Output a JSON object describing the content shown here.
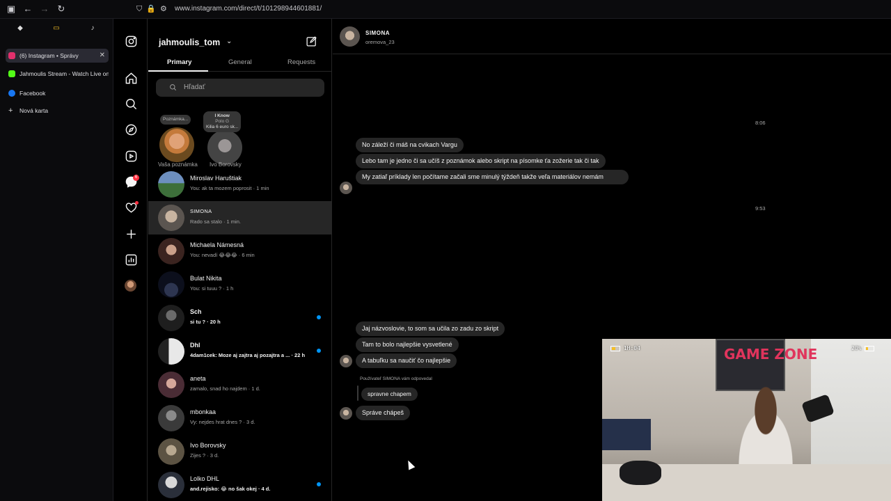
{
  "browser": {
    "url": "www.instagram.com/direct/t/101298944601881/",
    "tabs": [
      {
        "label": "(6) Instagram • Správy",
        "active": true,
        "favicon_color": "#e1306c"
      },
      {
        "label": "Jahmoulis Stream - Watch Live on K",
        "active": false,
        "favicon_color": "#53fc18"
      },
      {
        "label": "Facebook",
        "active": false,
        "favicon_color": "#1877f2"
      },
      {
        "label": "Nová karta",
        "active": false,
        "favicon_color": ""
      }
    ]
  },
  "nav": {
    "icons": [
      "instagram-logo-icon",
      "home-icon",
      "search-icon",
      "explore-icon",
      "reels-icon",
      "messenger-icon",
      "heart-icon",
      "create-icon",
      "dashboard-icon",
      "profile-avatar"
    ],
    "messages_badge": "6"
  },
  "inbox": {
    "username": "jahmoulis_tom",
    "tabs": [
      "Primary",
      "General",
      "Requests"
    ],
    "search_placeholder": "Hľadať",
    "notes": [
      {
        "bubble": "Poznámka...",
        "label": "Vaša poznámka"
      },
      {
        "bubble_line1": "I Know",
        "bubble_line2": "Polo G",
        "bubble_line3": "Kilia 6 euro sk...",
        "label": "Ivo Borovsky"
      }
    ],
    "conversations": [
      {
        "name": "Miroslav Haruštiak",
        "preview": "You: ak ta mozem poprosit · 1 min",
        "unread": false,
        "active": false
      },
      {
        "name": "SIMONA",
        "preview": "Rado sa stalo · 1 min.",
        "unread": false,
        "active": true
      },
      {
        "name": "Michaela Námesná",
        "preview": "You: nevadí 😂😂😂 · 6 min",
        "unread": false,
        "active": false
      },
      {
        "name": "Bulat Nikita",
        "preview": "You: si tuuu ? · 1 h",
        "unread": false,
        "active": false
      },
      {
        "name": "Sch",
        "preview": "si tu ? · 20 h",
        "unread": true,
        "active": false
      },
      {
        "name": "Dhl",
        "preview": "4dam1cek: Moze aj zajtra aj pozajtra a ... · 22 h",
        "unread": true,
        "active": false
      },
      {
        "name": "aneta",
        "preview": "zamalo, snad ho najdem · 1 d.",
        "unread": false,
        "active": false
      },
      {
        "name": "mbonkaa",
        "preview": "Vy: nejdes hrat dnes ? · 3 d.",
        "unread": false,
        "active": false
      },
      {
        "name": "Ivo Borovsky",
        "preview": "Zijes ? · 3 d.",
        "unread": false,
        "active": false
      },
      {
        "name": "Lolko DHL",
        "preview": "and.rejisko: 😂 no šak okej · 4 d.",
        "unread": true,
        "active": false
      }
    ]
  },
  "chat": {
    "name": "SIMONA",
    "handle": "oremova_23",
    "timestamps": [
      "8:06",
      "9:53"
    ],
    "messages_1": [
      "No záleží či máš na cvikach Vargu",
      "Lebo tam je jedno či sa učíš z poznámok alebo skript na písomke ťa zožerie tak či tak",
      "My zatiaľ príklady len počítame začali sme minulý týždeň takže veľa materiálov nemám"
    ],
    "messages_2": [
      "Jaj názvoslovie, to som sa učila zo zadu zo skript",
      "Tam to bolo najlepšie vysvetlené",
      "A tabuľku sa naučiť čo najlepšie"
    ],
    "reply_label": "Používateľ SIMONA vám odpovedal",
    "replied_to": "spravne chapem",
    "reply_message": "Správe chápeš"
  },
  "webcam": {
    "battery_left": "1H:04",
    "battery_right": "20%",
    "poster_text": "GAME ZONE"
  }
}
